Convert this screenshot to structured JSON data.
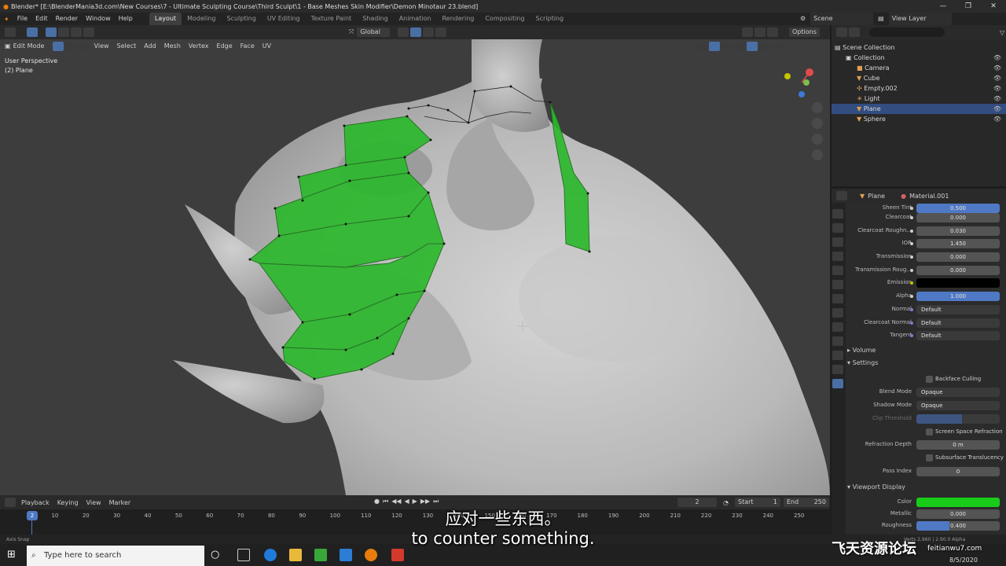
{
  "window": {
    "title": "Blender* [E:\\BlenderMania3d.com\\New Courses\\7 - Ultimate Sculpting Course\\Third Sculpt\\1 - Base Meshes Skin Modifier\\Demon Minotaur 23.blend]",
    "controls": [
      "—",
      "❐",
      "✕"
    ]
  },
  "menu": [
    "File",
    "Edit",
    "Render",
    "Window",
    "Help"
  ],
  "workspaces": [
    "Layout",
    "Modeling",
    "Sculpting",
    "UV Editing",
    "Texture Paint",
    "Shading",
    "Animation",
    "Rendering",
    "Compositing",
    "Scripting"
  ],
  "active_workspace": "Layout",
  "scene_label": "Scene",
  "view_layer_label": "View Layer",
  "header": {
    "transform_orientation": "Global",
    "options": "Options",
    "mode": "Edit Mode",
    "menus": [
      "View",
      "Select",
      "Add",
      "Mesh",
      "Vertex",
      "Edge",
      "Face",
      "UV"
    ]
  },
  "viewport": {
    "view_name": "User Perspective",
    "object_name": "(2) Plane"
  },
  "outliner": {
    "root": "Scene Collection",
    "collection": "Collection",
    "items": [
      {
        "name": "Camera",
        "selected": false
      },
      {
        "name": "Cube",
        "selected": false
      },
      {
        "name": "Empty.002",
        "selected": false
      },
      {
        "name": "Light",
        "selected": false
      },
      {
        "name": "Plane",
        "selected": true
      },
      {
        "name": "Sphere",
        "selected": false
      }
    ]
  },
  "properties": {
    "object": "Plane",
    "material": "Material.001",
    "rows": [
      {
        "label": "Sheen Tint",
        "value": "0.500",
        "style": "blue"
      },
      {
        "label": "Clearcoat",
        "value": "0.000",
        "style": "grey"
      },
      {
        "label": "Clearcoat Roughn...",
        "value": "0.030",
        "style": "grey"
      },
      {
        "label": "IOR",
        "value": "1.450",
        "style": "grey"
      },
      {
        "label": "Transmission",
        "value": "0.000",
        "style": "grey"
      },
      {
        "label": "Transmission Roug...",
        "value": "0.000",
        "style": "grey"
      },
      {
        "label": "Emission",
        "value": "",
        "style": "black"
      },
      {
        "label": "Alpha",
        "value": "1.000",
        "style": "blue"
      },
      {
        "label": "Normal",
        "value": "Default",
        "style": "dark"
      },
      {
        "label": "Clearcoat Normal",
        "value": "Default",
        "style": "dark"
      },
      {
        "label": "Tangent",
        "value": "Default",
        "style": "dark"
      }
    ],
    "section_volume": "Volume",
    "section_settings": "Settings",
    "backface_culling": "Backface Culling",
    "blend_mode_label": "Blend Mode",
    "blend_mode": "Opaque",
    "shadow_mode_label": "Shadow Mode",
    "shadow_mode": "Opaque",
    "clip_threshold_label": "Clip Threshold",
    "screen_space_refraction": "Screen Space Refraction",
    "refraction_depth_label": "Refraction Depth",
    "refraction_depth": "0 m",
    "subsurface_translucency": "Subsurface Translucency",
    "pass_index_label": "Pass Index",
    "pass_index": "0",
    "section_viewport_display": "Viewport Display",
    "color_label": "Color",
    "color_value": "#19cc19",
    "metallic_label": "Metallic",
    "metallic": "0.000",
    "roughness_label": "Roughness",
    "roughness": "0.400"
  },
  "timeline": {
    "menus": [
      "Playback",
      "Keying",
      "View",
      "Marker"
    ],
    "current_frame": "2",
    "start_label": "Start",
    "start": "1",
    "end_label": "End",
    "end": "250",
    "ticks": [
      "2",
      "10",
      "20",
      "30",
      "40",
      "50",
      "60",
      "70",
      "80",
      "90",
      "100",
      "110",
      "120",
      "130",
      "140",
      "150",
      "160",
      "170",
      "180",
      "190",
      "200",
      "210",
      "220",
      "230",
      "240",
      "250"
    ]
  },
  "status": {
    "left": "Axis Snap",
    "right": "Verts 2,960 | 2.90.0 Alpha"
  },
  "taskbar": {
    "search_placeholder": "Type here to search"
  },
  "subtitles": {
    "chinese": "应对一些东西。",
    "english": "to counter something."
  },
  "watermark": {
    "main": "飞天资源论坛",
    "url": "feitianwu7.com",
    "time": "8/5/2020"
  },
  "colors": {
    "accent": "#4a6fa5",
    "mesh_green": "#2db82d",
    "selection": "#334d80"
  }
}
